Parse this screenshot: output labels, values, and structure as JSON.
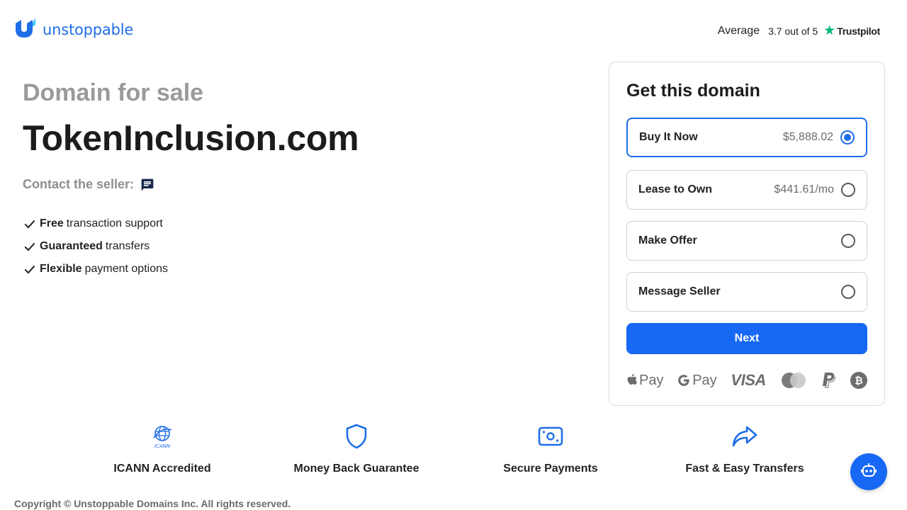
{
  "brand": {
    "name": "unstoppable",
    "accent": "#1f6ee8"
  },
  "trustpilot": {
    "average_label": "Average",
    "score": "3.7 out of 5",
    "brand": "Trustpilot",
    "star_color": "#00b67a"
  },
  "hero": {
    "eyebrow": "Domain for sale",
    "domain": "TokenInclusion.com",
    "contact_label": "Contact the seller:",
    "features": [
      {
        "bold": "Free",
        "rest": "transaction support"
      },
      {
        "bold": "Guaranteed",
        "rest": "transfers"
      },
      {
        "bold": "Flexible",
        "rest": "payment options"
      }
    ]
  },
  "purchase": {
    "title": "Get this domain",
    "options": [
      {
        "label": "Buy It Now",
        "price": "$5,888.02",
        "selected": true
      },
      {
        "label": "Lease to Own",
        "price": "$441.61/mo",
        "selected": false
      },
      {
        "label": "Make Offer",
        "price": "",
        "selected": false
      },
      {
        "label": "Message Seller",
        "price": "",
        "selected": false
      }
    ],
    "next_label": "Next",
    "payment_methods": {
      "apple_pay": "Pay",
      "google_pay": "Pay",
      "visa": "VISA",
      "icons": [
        "apple-pay-icon",
        "google-pay-icon",
        "visa-icon",
        "mastercard-icon",
        "paypal-icon",
        "bitcoin-icon"
      ]
    }
  },
  "badges": [
    {
      "label": "ICANN Accredited",
      "icon": "icann-icon"
    },
    {
      "label": "Money Back Guarantee",
      "icon": "shield-icon"
    },
    {
      "label": "Secure Payments",
      "icon": "cash-icon"
    },
    {
      "label": "Fast & Easy Transfers",
      "icon": "share-arrow-icon"
    }
  ],
  "footer": {
    "copyright": "Copyright © Unstoppable Domains Inc. All rights reserved."
  },
  "colors": {
    "primary_button": "#1768f5",
    "muted_text": "#9a9a9a"
  }
}
